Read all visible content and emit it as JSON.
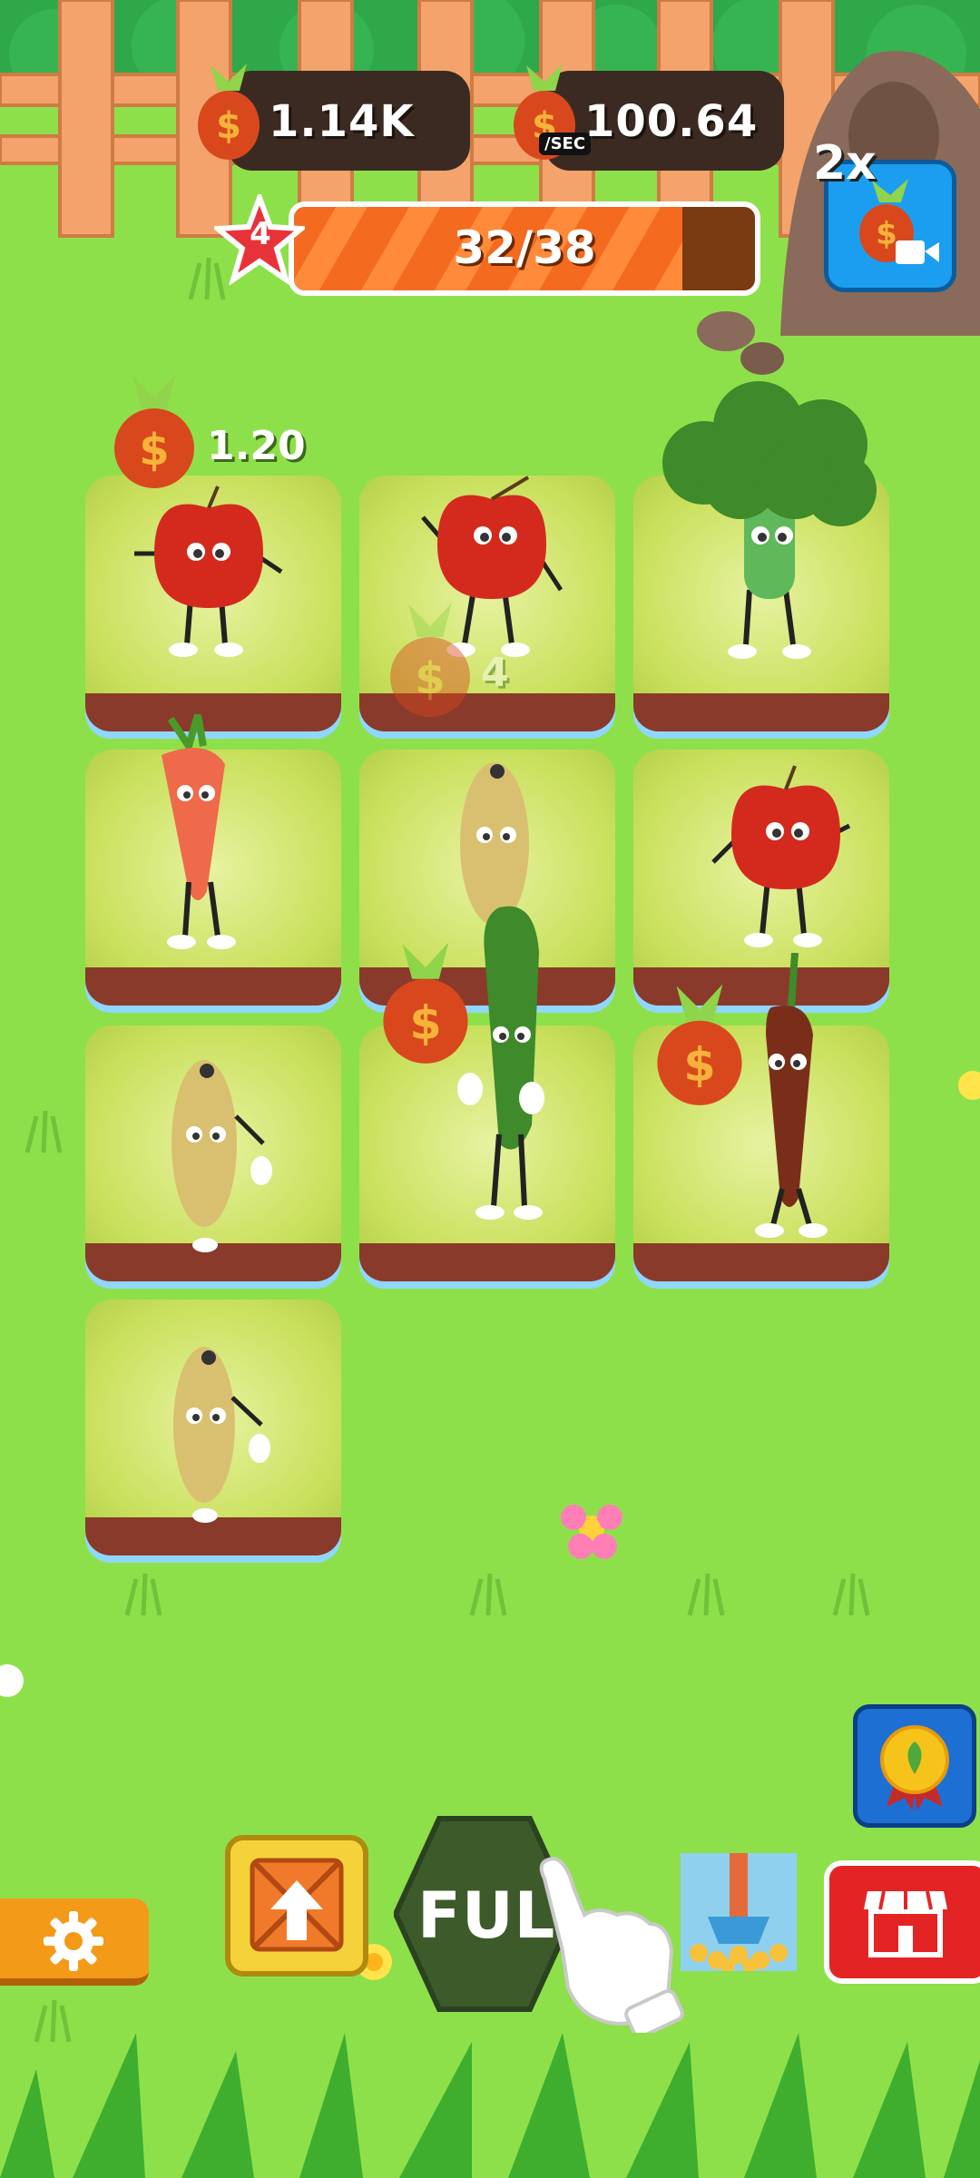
{
  "hud": {
    "coins": "1.14K",
    "income": "100.64",
    "income_unit": "/SEC",
    "level": "4",
    "progress_text": "32/38",
    "progress": 0.842,
    "boost_label": "2x"
  },
  "grid": {
    "first_tile_earning": "1.20",
    "faded_coin_value": "4",
    "tiles": [
      {
        "character": "apple"
      },
      {
        "character": "apple"
      },
      {
        "character": "broccoli"
      },
      {
        "character": "carrot"
      },
      {
        "character": "potato"
      },
      {
        "character": "apple"
      },
      {
        "character": "potato"
      },
      {
        "character": "cucumber"
      },
      {
        "character": "chili"
      },
      {
        "character": "potato"
      }
    ]
  },
  "bottom": {
    "full_label": "FULL",
    "settings_icon": "gear-icon",
    "crate_icon": "crate-upgrade-icon",
    "shop_icon": "shop-icon",
    "award_icon": "award-icon"
  },
  "colors": {
    "grass": "#8ee04a",
    "fence": "#f3a36b",
    "progress_fill": "#f46a1f",
    "full_button": "#3d5a2b",
    "shop_button": "#e42424",
    "crate_button": "#f6d23a",
    "settings_button": "#f39a18",
    "boost_button": "#1c9ef0"
  }
}
